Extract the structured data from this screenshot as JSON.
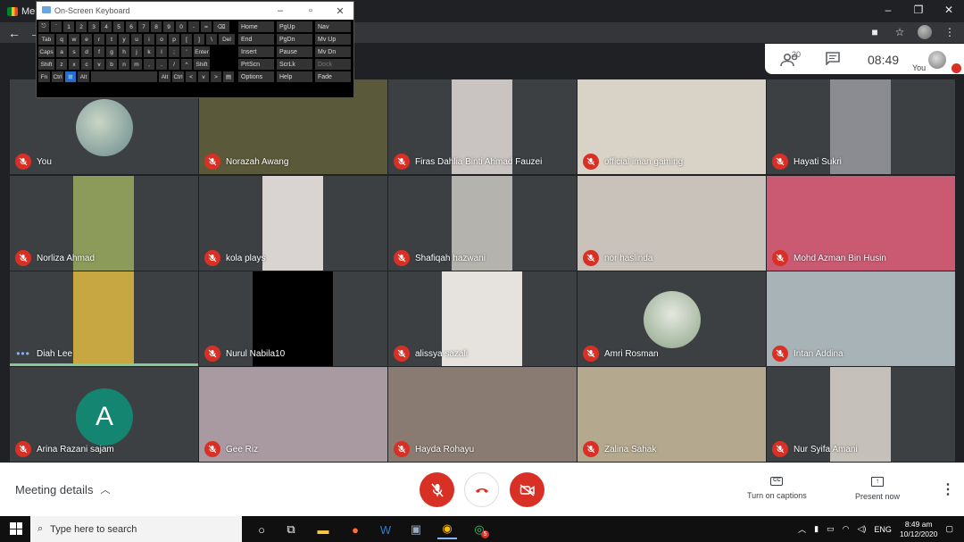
{
  "browser": {
    "tab_label": "Me",
    "window_controls": [
      "–",
      "❐",
      "✕"
    ]
  },
  "keyboard": {
    "title": "On-Screen Keyboard",
    "rows": [
      [
        "⎋",
        "`",
        "1",
        "2",
        "3",
        "4",
        "5",
        "6",
        "7",
        "8",
        "9",
        "0",
        "-",
        "=",
        "⌫"
      ],
      [
        "Tab",
        "q",
        "w",
        "e",
        "r",
        "t",
        "y",
        "u",
        "i",
        "o",
        "p",
        "[",
        "]",
        "\\",
        "Del"
      ],
      [
        "Caps",
        "a",
        "s",
        "d",
        "f",
        "g",
        "h",
        "j",
        "k",
        "l",
        ";",
        "'",
        "Enter"
      ],
      [
        "Shift",
        "z",
        "x",
        "c",
        "v",
        "b",
        "n",
        "m",
        ",",
        ".",
        "/",
        "^",
        "Shift"
      ],
      [
        "Fn",
        "Ctrl",
        "⊞",
        "Alt",
        "",
        "Alt",
        "Ctrl",
        "<",
        "v",
        ">",
        "▤"
      ]
    ],
    "side": [
      [
        "Home",
        "PgUp",
        "Nav"
      ],
      [
        "End",
        "PgDn",
        "Mv Up"
      ],
      [
        "Insert",
        "Pause",
        "Mv Dn"
      ],
      [
        "PrtScn",
        "ScrLk",
        "Dock"
      ],
      [
        "Options",
        "Help",
        "Fade"
      ]
    ]
  },
  "meet_header": {
    "people_count": "20",
    "time": "08:49",
    "self_label": "You"
  },
  "participants": [
    {
      "name": "You",
      "bg": "#2b2d30",
      "speaking": false
    },
    {
      "name": "Norazah Awang",
      "bg": "#5a5a3a",
      "speaking": false
    },
    {
      "name": "Firas Dahlia Binti Ahmad Fauzei",
      "bg": "#c9c4c2",
      "speaking": false
    },
    {
      "name": "official iman gaming",
      "bg": "#d8d2c7",
      "speaking": false
    },
    {
      "name": "Hayati Sukri",
      "bg": "#8a8c91",
      "speaking": false
    },
    {
      "name": "Norliza Ahmad",
      "bg": "#8c9a5a",
      "speaking": false
    },
    {
      "name": "kola plays",
      "bg": "#d9d4d1",
      "speaking": false
    },
    {
      "name": "Shafiqah hazwani",
      "bg": "#b5b3ad",
      "speaking": false
    },
    {
      "name": "nor haslinda",
      "bg": "#c8c2bb",
      "speaking": false
    },
    {
      "name": "Mohd Azman Bin Husin",
      "bg": "#c95a72",
      "speaking": false
    },
    {
      "name": "Diah Lee",
      "bg": "#c7a742",
      "speaking": true
    },
    {
      "name": "Nurul Nabila10",
      "bg": "#000000",
      "speaking": false
    },
    {
      "name": "alissya sazali",
      "bg": "#e6e3df",
      "speaking": false
    },
    {
      "name": "Amri Rosman",
      "bg": "#3c4043",
      "speaking": false
    },
    {
      "name": "Intan Addina",
      "bg": "#a7b3b6",
      "speaking": false
    },
    {
      "name": "Arina Razani sajam",
      "bg": "#3c4043",
      "speaking": false,
      "initial": "A"
    },
    {
      "name": "Gee Riz",
      "bg": "#a89aa0",
      "speaking": false
    },
    {
      "name": "Hayda Rohayu",
      "bg": "#8a7b72",
      "speaking": false
    },
    {
      "name": "Zalina Sahak",
      "bg": "#b4a88f",
      "speaking": false
    },
    {
      "name": "Nur Syifa Amani",
      "bg": "#c5c0ba",
      "speaking": false
    }
  ],
  "bottom": {
    "meeting_details": "Meeting details",
    "captions": "Turn on captions",
    "present": "Present now"
  },
  "taskbar": {
    "search_placeholder": "Type here to search",
    "lang": "ENG",
    "time": "8:49 am",
    "date": "10/12/2020",
    "whatsapp_badge": "5"
  },
  "colors": {
    "meet_red": "#d93025",
    "speaking_green": "#81c995",
    "avatar_teal": "#138570"
  }
}
